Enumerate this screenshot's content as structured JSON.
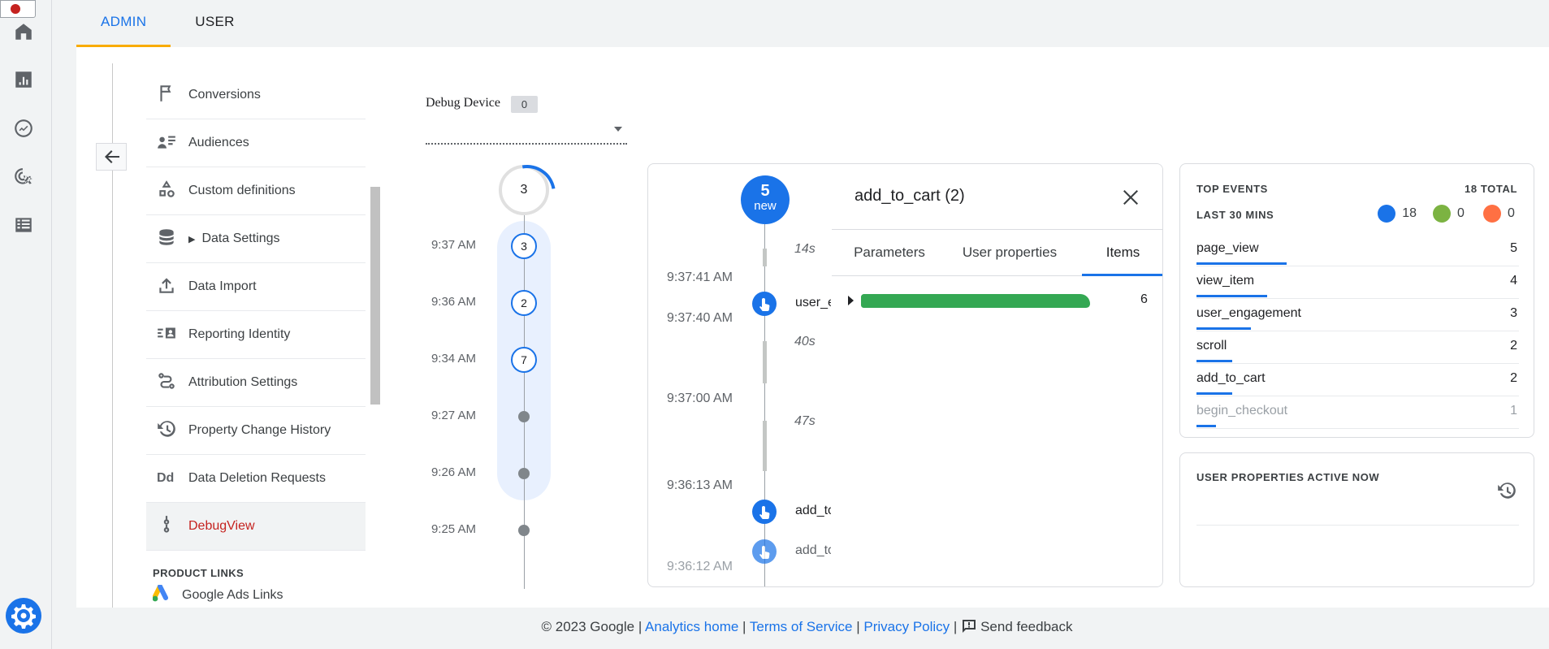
{
  "tabs": [
    {
      "label": "ADMIN",
      "active": true
    },
    {
      "label": "USER",
      "active": false
    }
  ],
  "rail": {
    "icons": [
      "home-icon",
      "reports-icon",
      "explore-icon",
      "advertising-icon",
      "configure-icon"
    ],
    "settings_icon": "settings-gear-icon"
  },
  "nav": {
    "items": [
      {
        "label": "Conversions",
        "icon": "flag-icon"
      },
      {
        "label": "Audiences",
        "icon": "audience-icon"
      },
      {
        "label": "Custom definitions",
        "icon": "shapes-icon"
      },
      {
        "label": "Data Settings",
        "icon": "database-icon",
        "expandable": true
      },
      {
        "label": "Data Import",
        "icon": "upload-icon"
      },
      {
        "label": "Reporting Identity",
        "icon": "identity-icon"
      },
      {
        "label": "Attribution Settings",
        "icon": "attribution-icon"
      },
      {
        "label": "Property Change History",
        "icon": "history-icon"
      },
      {
        "label": "Data Deletion Requests",
        "icon": "dd-icon"
      },
      {
        "label": "DebugView",
        "icon": "debug-icon",
        "active": true
      }
    ],
    "section_label": "PRODUCT LINKS",
    "google_ads_label": "Google Ads Links"
  },
  "debug_device": {
    "label": "Debug Device",
    "count": "0"
  },
  "minutes": {
    "top_count": "3",
    "rows": [
      {
        "time": "9:37 AM",
        "count": "3"
      },
      {
        "time": "9:36 AM",
        "count": "2"
      },
      {
        "time": "9:34 AM",
        "count": "7"
      },
      {
        "time": "9:27 AM",
        "count": ""
      },
      {
        "time": "9:26 AM",
        "count": ""
      },
      {
        "time": "9:25 AM",
        "count": ""
      }
    ]
  },
  "seconds": {
    "new_count": "5",
    "new_label": "new",
    "gaps": [
      "14s",
      "40s",
      "47s"
    ],
    "times": [
      "9:37:41 AM",
      "9:37:40 AM",
      "9:37:00 AM",
      "9:36:13 AM",
      "9:36:12 AM"
    ],
    "events": [
      "user_engagement",
      "add_to_cart",
      "add_to_cart"
    ]
  },
  "event_details": {
    "title": "add_to_cart (2)",
    "tabs": [
      "Parameters",
      "User properties",
      "Items"
    ],
    "active_tab": "Items",
    "item_count": "6"
  },
  "top_events": {
    "title": "TOP EVENTS",
    "total": "18 TOTAL",
    "subtitle": "LAST 30 MINS",
    "legend": [
      {
        "icon": "event-icon",
        "value": "18",
        "color": "#1a73e8"
      },
      {
        "icon": "conversion-flag-icon",
        "value": "0",
        "color": "#7cb342"
      },
      {
        "icon": "error-icon",
        "value": "0",
        "color": "#ff7043"
      }
    ],
    "events": [
      {
        "name": "page_view",
        "count": "5",
        "share": 0.28
      },
      {
        "name": "view_item",
        "count": "4",
        "share": 0.22
      },
      {
        "name": "user_engagement",
        "count": "3",
        "share": 0.17
      },
      {
        "name": "scroll",
        "count": "2",
        "share": 0.11
      },
      {
        "name": "add_to_cart",
        "count": "2",
        "share": 0.11
      },
      {
        "name": "begin_checkout",
        "count": "1",
        "share": 0.06
      }
    ]
  },
  "user_properties": {
    "title": "USER PROPERTIES ACTIVE NOW"
  },
  "footer": {
    "copyright": "© 2023 Google |",
    "analytics_home": "Analytics home",
    "sep1": "|",
    "terms": "Terms of Service",
    "sep2": "|",
    "privacy": "Privacy Policy",
    "sep3": "|",
    "feedback": "Send feedback"
  }
}
